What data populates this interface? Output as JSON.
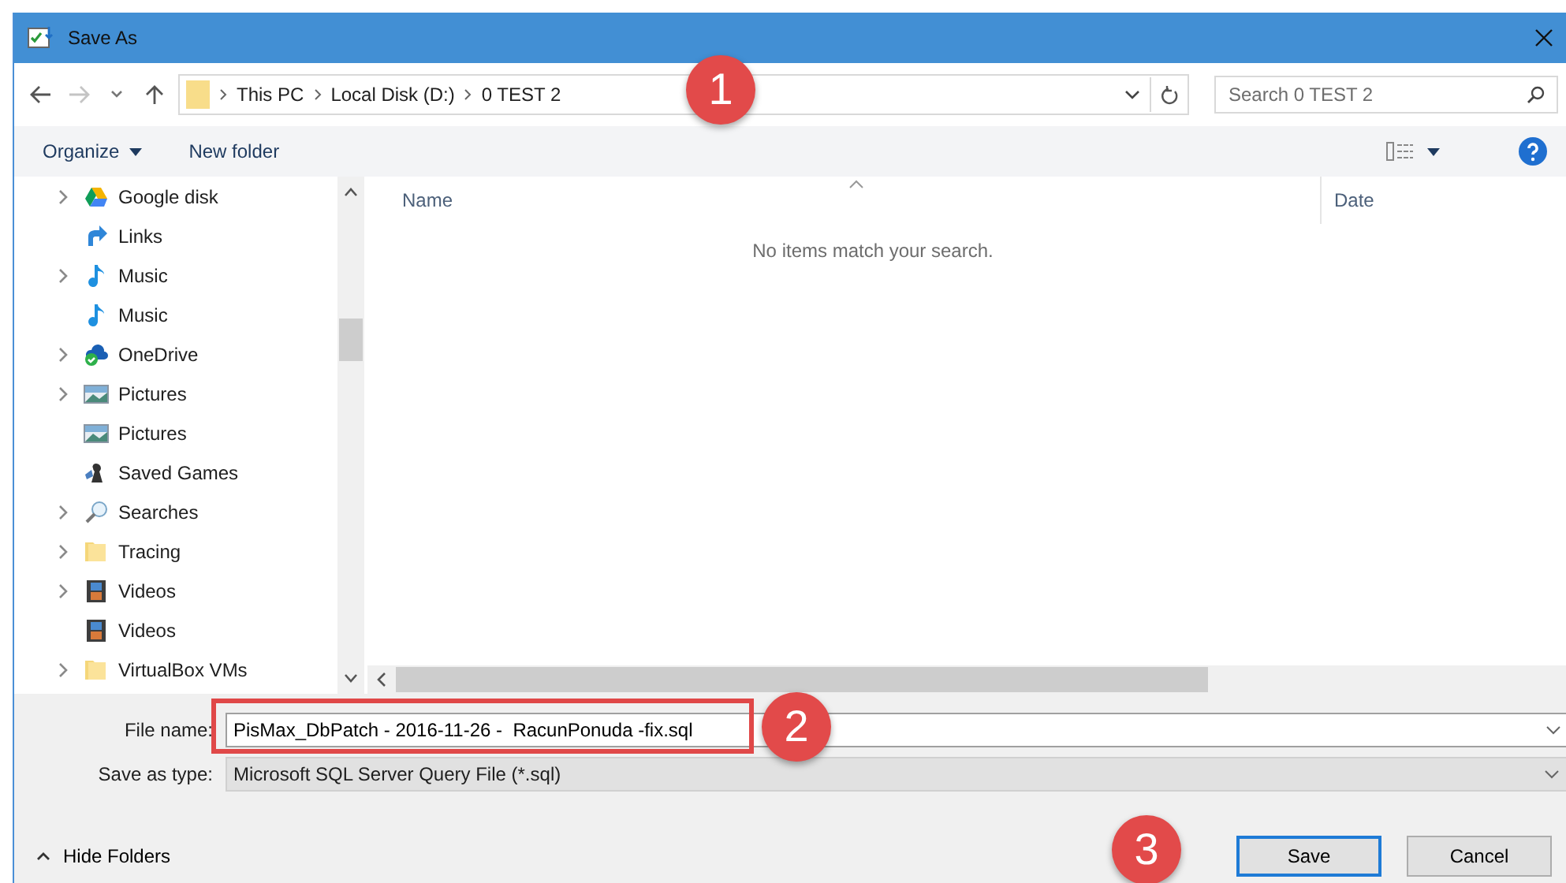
{
  "window": {
    "title": "Save As"
  },
  "address": {
    "crumbs": [
      "This PC",
      "Local Disk (D:)",
      "0 TEST 2"
    ]
  },
  "search": {
    "placeholder": "Search 0 TEST 2"
  },
  "toolbar": {
    "organize": "Organize",
    "new_folder": "New folder"
  },
  "tree": [
    {
      "label": "Google disk",
      "kind": "drive",
      "expandable": true
    },
    {
      "label": "Links",
      "kind": "links",
      "expandable": false
    },
    {
      "label": "Music",
      "kind": "music",
      "expandable": true
    },
    {
      "label": "Music",
      "kind": "music",
      "expandable": false
    },
    {
      "label": "OneDrive",
      "kind": "cloud",
      "expandable": true
    },
    {
      "label": "Pictures",
      "kind": "pictures",
      "expandable": true
    },
    {
      "label": "Pictures",
      "kind": "pictures",
      "expandable": false
    },
    {
      "label": "Saved Games",
      "kind": "games",
      "expandable": false
    },
    {
      "label": "Searches",
      "kind": "search",
      "expandable": true
    },
    {
      "label": "Tracing",
      "kind": "folder",
      "expandable": true
    },
    {
      "label": "Videos",
      "kind": "videos",
      "expandable": true
    },
    {
      "label": "Videos",
      "kind": "videos",
      "expandable": false
    },
    {
      "label": "VirtualBox VMs",
      "kind": "folder",
      "expandable": true
    }
  ],
  "columns": [
    "Name",
    "Date"
  ],
  "empty_message": "No items match your search.",
  "file_name": {
    "label": "File name:",
    "value": "PisMax_DbPatch - 2016-11-26 -  RacunPonuda -fix.sql",
    "highlighted": true
  },
  "save_type": {
    "label": "Save as type:",
    "value": "Microsoft SQL Server Query File (*.sql)"
  },
  "hide_folders": "Hide Folders",
  "buttons": [
    {
      "label": "Save",
      "default": true
    },
    {
      "label": "Cancel",
      "default": false
    }
  ],
  "markers": [
    "1",
    "2",
    "3"
  ]
}
